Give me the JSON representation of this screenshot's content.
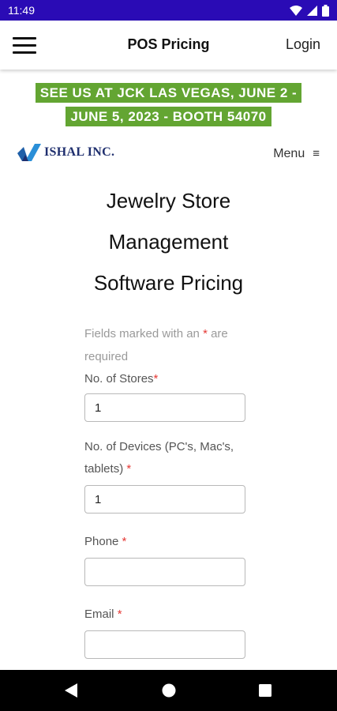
{
  "status_bar": {
    "time": "11:49"
  },
  "app_bar": {
    "title": "POS Pricing",
    "login_label": "Login"
  },
  "banner": {
    "line1": "SEE US AT JCK LAS VEGAS, JUNE 2 -",
    "line2": "JUNE 5, 2023 - BOOTH 54070"
  },
  "brand": {
    "logo_text": "ISHAL INC.",
    "menu_label": "Menu",
    "menu_icon": "≡"
  },
  "page": {
    "heading_lines": [
      "Jewelry Store",
      "Management",
      "Software Pricing"
    ]
  },
  "form": {
    "note_prefix": "Fields marked with an ",
    "note_star": "*",
    "note_suffix": " are required",
    "stores_label": "No. of Stores",
    "stores_value": "1",
    "devices_label": "No. of Devices (PC's, Mac's, tablets)",
    "devices_value": "1",
    "phone_label": "Phone",
    "phone_value": "",
    "email_label": "Email",
    "email_value": "",
    "required_mark": "*"
  },
  "colors": {
    "status_bar": "#2a0bb5",
    "banner": "#63a532",
    "required": "#e53935",
    "logo": "#1f2f6e"
  }
}
